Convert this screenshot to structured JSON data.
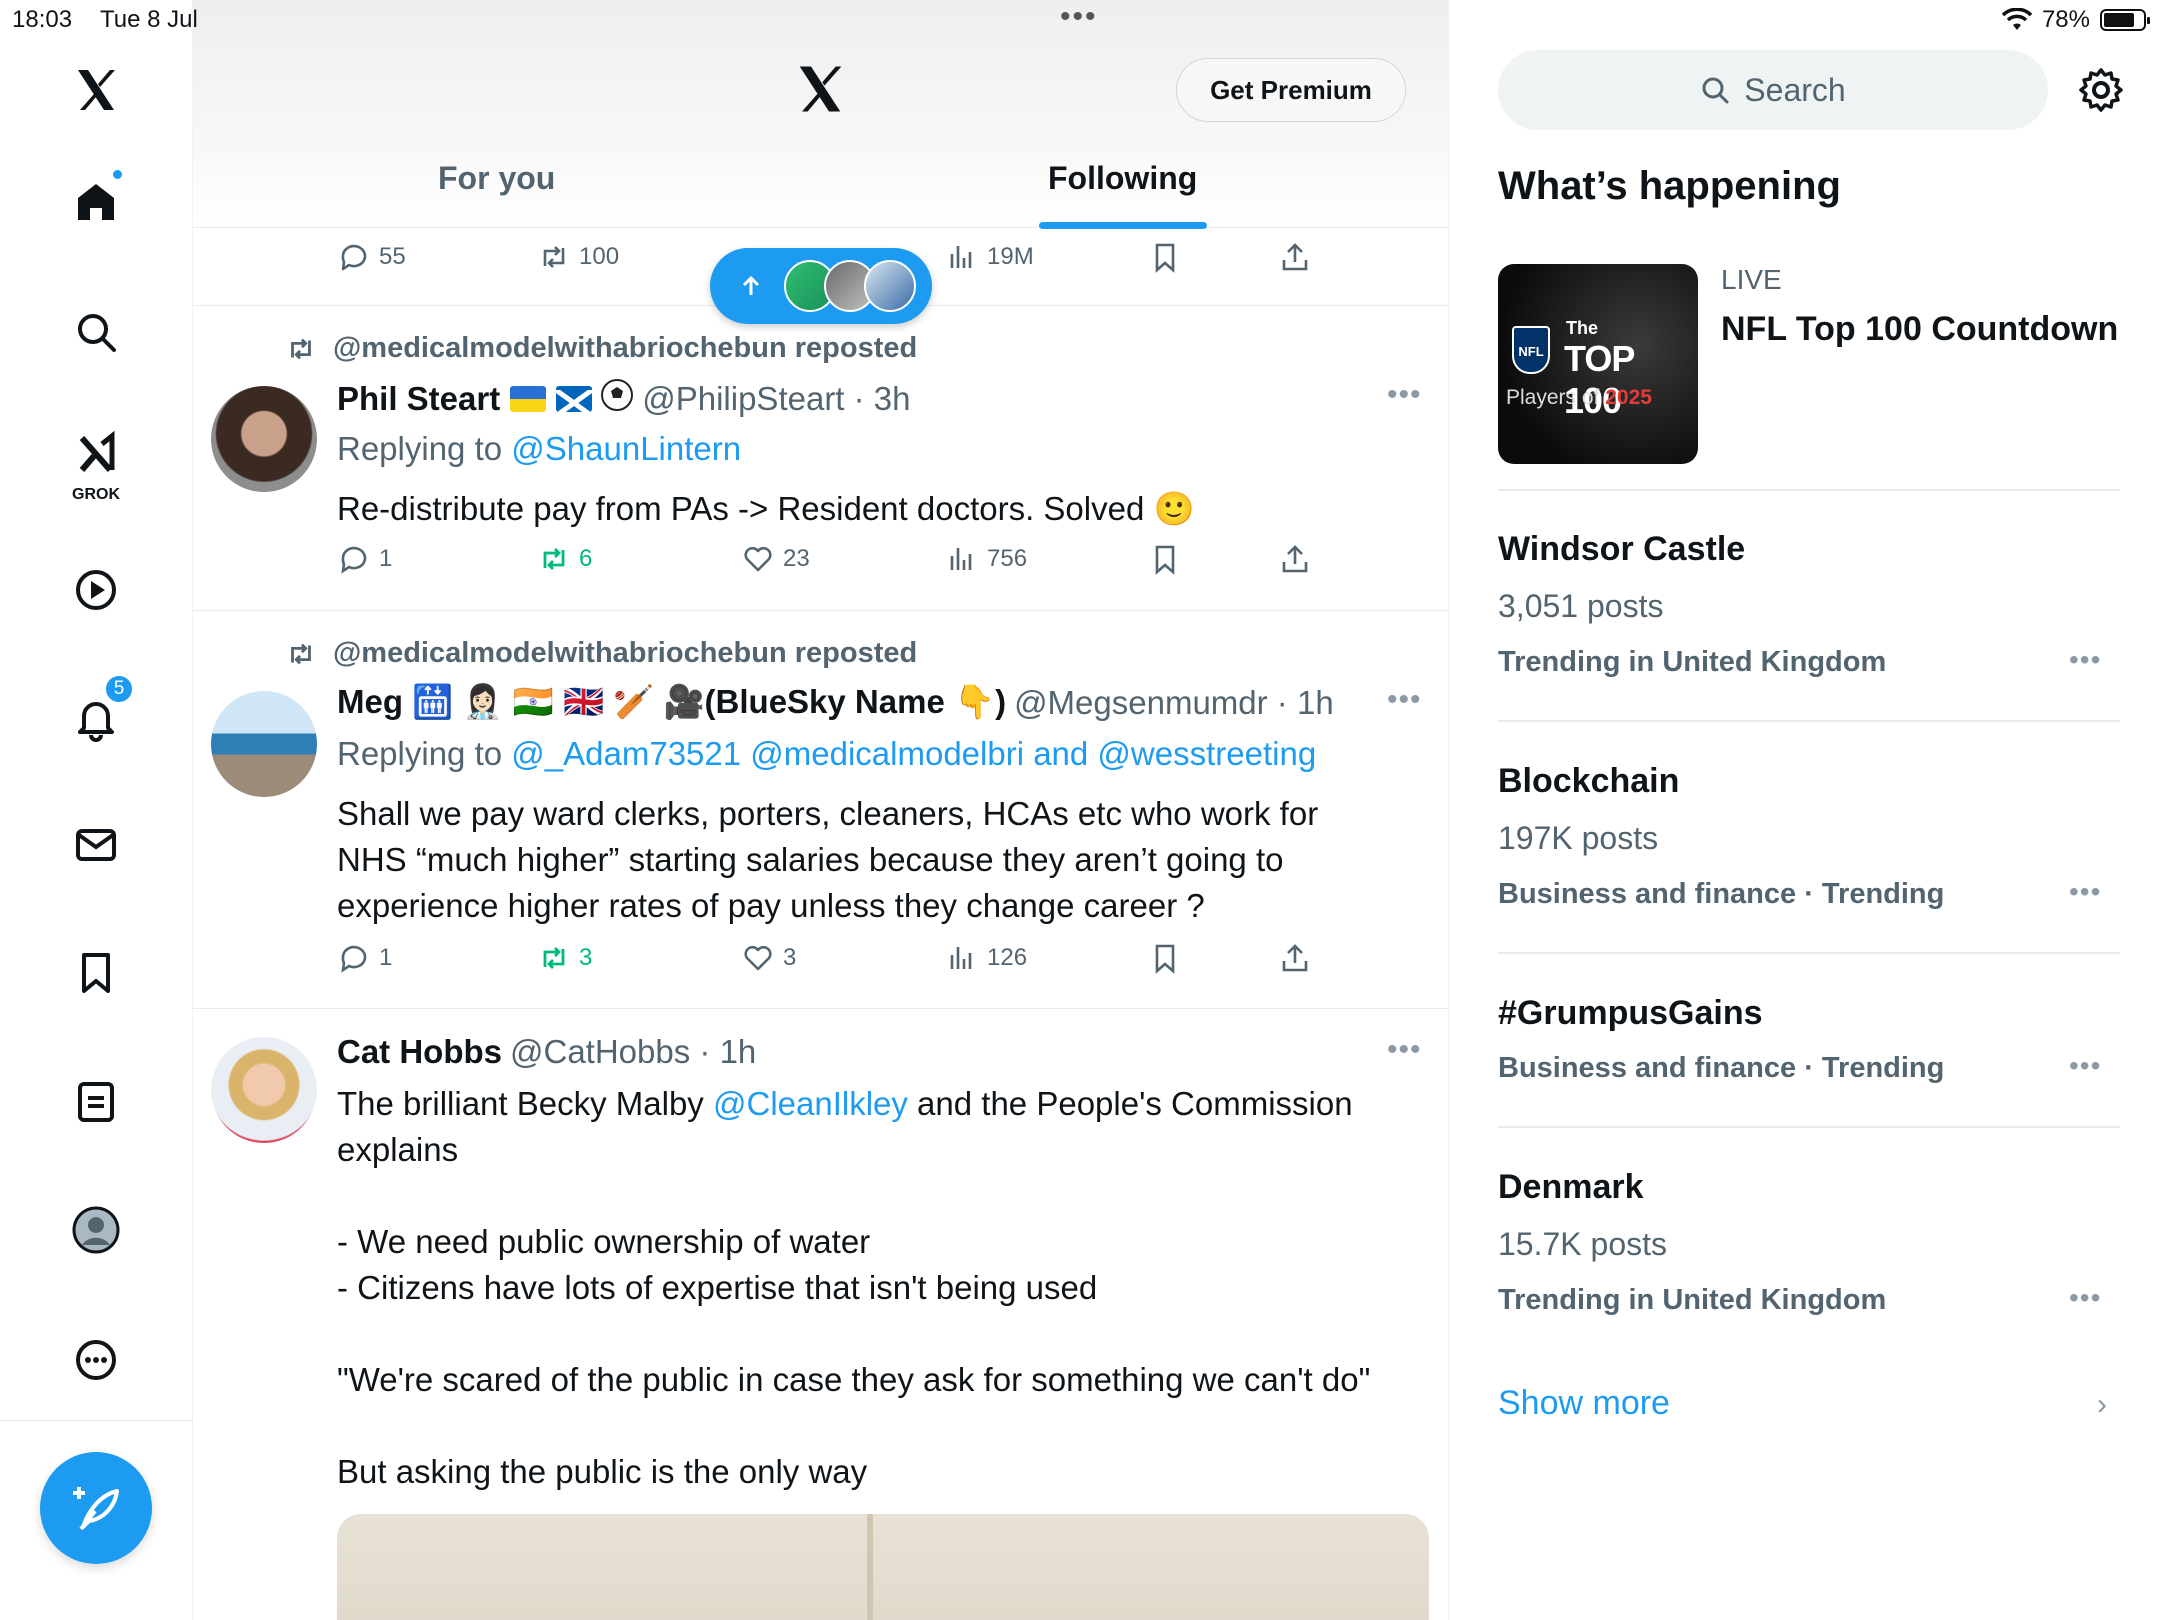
{
  "status_bar": {
    "time": "18:03",
    "date": "Tue 8 Jul",
    "battery": "78%"
  },
  "nav": {
    "grok_label": "GROK",
    "notifications_badge": "5"
  },
  "header": {
    "premium_label": "Get Premium",
    "tabs": [
      "For you",
      "Following"
    ],
    "active_tab": "Following"
  },
  "top_actions": {
    "replies": "55",
    "reposts": "100",
    "views": "19M"
  },
  "posts": [
    {
      "repost_by": "@medicalmodelwithabriochebun reposted",
      "name": "Phil Steart",
      "handle_time": "@PhilipSteart · 3h",
      "reply_prefix": "Replying to",
      "reply_to": "@ShaunLintern",
      "text": "Re-distribute pay from PAs -> Resident doctors. Solved 🙂",
      "replies": "1",
      "reposts": "6",
      "likes": "23",
      "views": "756"
    },
    {
      "repost_by": "@medicalmodelwithabriochebun reposted",
      "name": "Meg 🛗 👩🏻‍⚕️ 🇮🇳 🇬🇧 🏏 🎥(BlueSky Name 👇)",
      "handle_time": "@Megsenmumdr · 1h",
      "reply_prefix": "Replying to",
      "reply_to": "@_Adam73521 @medicalmodelbri and @wesstreeting",
      "text": "Shall we pay ward clerks, porters, cleaners, HCAs etc who work for\nNHS “much higher” starting salaries because they aren’t going to\nexperience higher rates of pay unless they change career ?",
      "replies": "1",
      "reposts": "3",
      "likes": "3",
      "views": "126"
    },
    {
      "name": "Cat Hobbs",
      "handle_time": "@CatHobbs · 1h",
      "text_before_link": "The brilliant Becky Malby ",
      "link": "@CleanIlkley",
      "text_after_link": " and the People's Commission\nexplains\n\n- We need public ownership of water\n- Citizens have lots of expertise that isn't being used\n\n\"We're scared of the public in case they ask for something we can't do\"\n\nBut asking the public is the only way"
    }
  ],
  "sidebar": {
    "search_placeholder": "Search",
    "section_title": "What’s happening",
    "live": {
      "label": "LIVE",
      "title": "NFL Top 100 Countdown",
      "card_line1": "The",
      "card_line2": "TOP 100",
      "card_line3_a": "Players of ",
      "card_line3_b": "2025",
      "card_shield": "NFL"
    },
    "trends": [
      {
        "title": "Windsor Castle",
        "posts": "3,051 posts",
        "category": "Trending in United Kingdom"
      },
      {
        "title": "Blockchain",
        "posts": "197K posts",
        "category": "Business and finance · Trending"
      },
      {
        "title": "#GrumpusGains",
        "category": "Business and finance · Trending"
      },
      {
        "title": "Denmark",
        "posts": "15.7K posts",
        "category": "Trending in United Kingdom"
      }
    ],
    "show_more": "Show more"
  },
  "colors": {
    "accent": "#1d9bf0",
    "secondary_text": "#536471",
    "repost_green": "#00ba7c"
  }
}
